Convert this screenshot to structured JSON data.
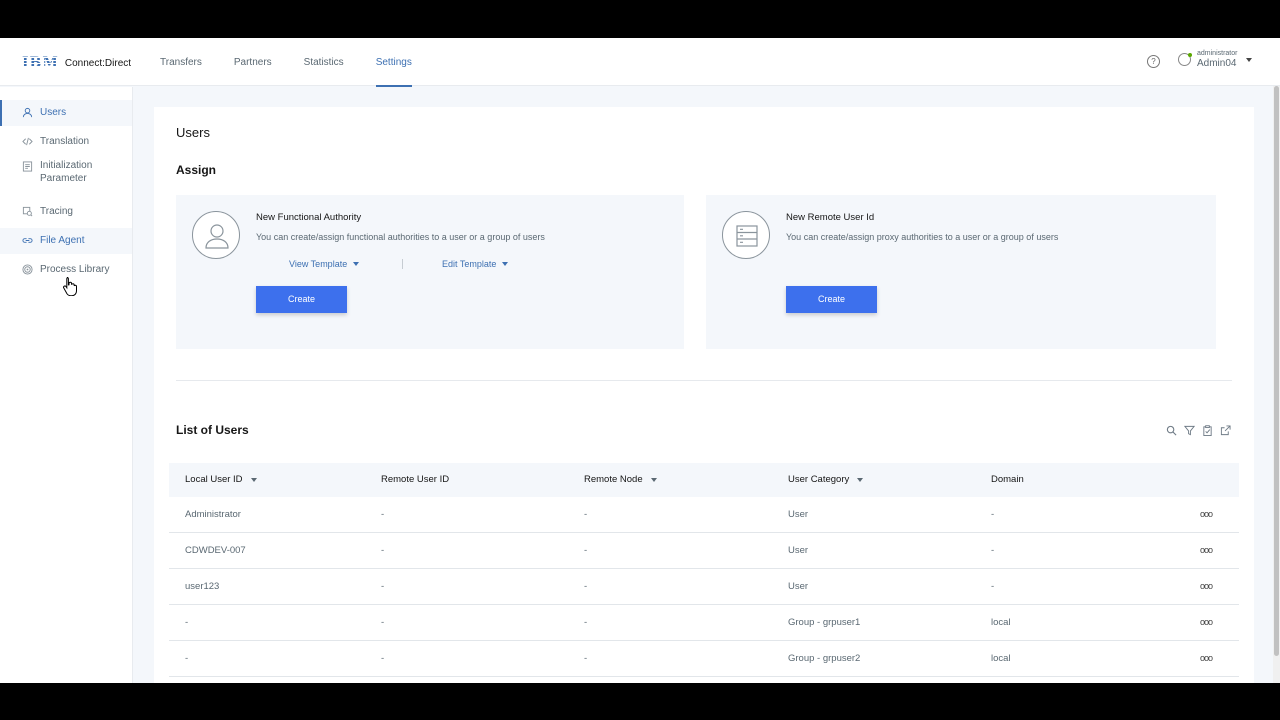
{
  "header": {
    "brand": "IBM",
    "product": "Connect:Direct",
    "nav": [
      "Transfers",
      "Partners",
      "Statistics",
      "Settings"
    ],
    "active_nav": "Settings",
    "help_glyph": "?",
    "user_role": "administrator",
    "user_name": "Admin04"
  },
  "sidebar": {
    "items": [
      {
        "label": "Users",
        "icon": "user-icon"
      },
      {
        "label": "Translation",
        "icon": "code-icon"
      },
      {
        "label": "Initialization Parameter",
        "icon": "document-icon"
      },
      {
        "label": "Tracing",
        "icon": "trace-icon"
      },
      {
        "label": "File Agent",
        "icon": "link-icon"
      },
      {
        "label": "Process Library",
        "icon": "fingerprint-icon"
      }
    ]
  },
  "page": {
    "title": "Users",
    "assign_title": "Assign",
    "tile1": {
      "title": "New Functional Authority",
      "desc": "You can create/assign functional authorities to a user or a group of users",
      "view_template": "View Template",
      "edit_template": "Edit Template",
      "create": "Create"
    },
    "tile2": {
      "title": "New Remote User Id",
      "desc": "You can create/assign proxy authorities to a user or a group of users",
      "create": "Create"
    },
    "list_title": "List of Users"
  },
  "table": {
    "columns": [
      "Local User ID",
      "Remote User ID",
      "Remote Node",
      "User Category",
      "Domain"
    ],
    "rows": [
      [
        "Administrator",
        "-",
        "-",
        "User",
        "-"
      ],
      [
        "CDWDEV-007",
        "-",
        "-",
        "User",
        "-"
      ],
      [
        "user123",
        "-",
        "-",
        "User",
        "-"
      ],
      [
        "-",
        "-",
        "-",
        "Group - grpuser1",
        "local"
      ],
      [
        "-",
        "-",
        "-",
        "Group - grpuser2",
        "local"
      ]
    ],
    "row_menu": "ooo"
  },
  "colors": {
    "accent": "#3d70b2",
    "button": "#3d70ed",
    "panel": "#f4f7fb"
  }
}
